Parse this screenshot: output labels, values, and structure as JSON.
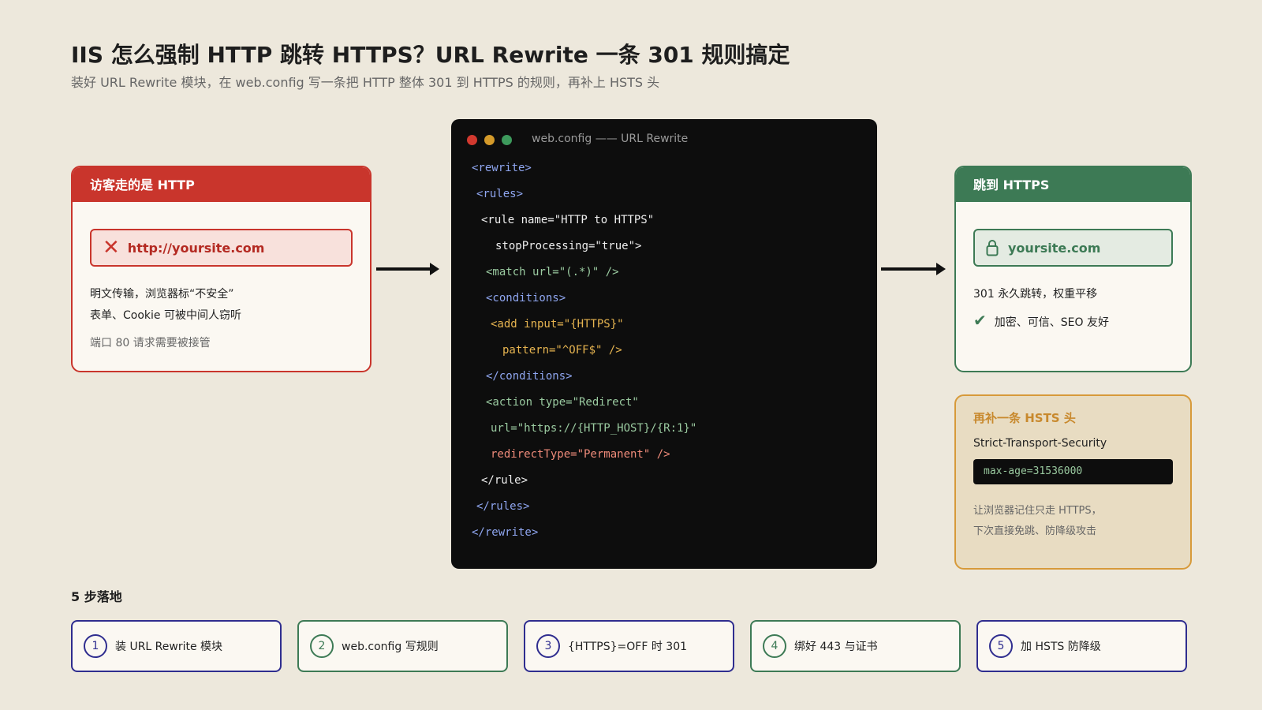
{
  "header": {
    "title": "IIS 怎么强制 HTTP 跳转 HTTPS？URL Rewrite 一条 301 规则搞定",
    "subtitle": "装好 URL Rewrite 模块，在 web.config 写一条把 HTTP 整体 301 到 HTTPS 的规则，再补上 HSTS 头"
  },
  "http_card": {
    "title": "访客走的是 HTTP",
    "url": "http://yoursite.com",
    "line1": "明文传输，浏览器标“不安全”",
    "line2": "表单、Cookie 可被中间人窃听",
    "line3": "端口 80 请求需要被接管",
    "icon": "x-icon"
  },
  "code_window": {
    "title": "web.config —— URL Rewrite",
    "lines": [
      "<rewrite>",
      "<rules>",
      "<rule name=\"HTTP to HTTPS\"",
      "stopProcessing=\"true\">",
      "<match url=\"(.*)\" />",
      "<conditions>",
      "<add input=\"{HTTPS}\"",
      "pattern=\"^OFF$\" />",
      "</conditions>",
      "<action type=\"Redirect\"",
      "url=\"https://{HTTP_HOST}/{R:1}\"",
      "redirectType=\"Permanent\" />",
      "</rule>",
      "</rules>",
      "</rewrite>"
    ]
  },
  "https_card": {
    "title": "跳到 HTTPS",
    "url": "yoursite.com",
    "line1": "301 永久跳转，权重平移",
    "line2": "加密、可信、SEO 友好",
    "icon": "lock-icon"
  },
  "hsts_card": {
    "title": "再补一条 HSTS 头",
    "header_name": "Strict-Transport-Security",
    "header_value": "max-age=31536000",
    "note1": "让浏览器记住只走 HTTPS，",
    "note2": "下次直接免跳、防降级攻击"
  },
  "steps": {
    "title": "5 步落地",
    "items": [
      {
        "num": "1",
        "label": "装 URL Rewrite 模块"
      },
      {
        "num": "2",
        "label": "web.config 写规则"
      },
      {
        "num": "3",
        "label": "{HTTPS}=OFF 时 301"
      },
      {
        "num": "4",
        "label": "绑好 443 与证书"
      },
      {
        "num": "5",
        "label": "加 HSTS 防降级"
      }
    ]
  },
  "colors": {
    "background": "#ede8dc",
    "http_red": "#c9352c",
    "https_green": "#3d7a55",
    "hsts_orange": "#d79a3a",
    "step_blue": "#2f2d8f",
    "code_bg": "#0d0d0d"
  }
}
